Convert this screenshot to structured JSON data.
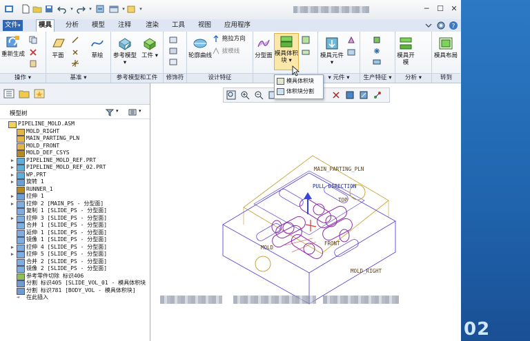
{
  "menu": {
    "file": "文件",
    "file_arrow": "▾"
  },
  "tabs": [
    "模具",
    "分析",
    "模型",
    "注释",
    "渲染",
    "工具",
    "视图",
    "应用程序"
  ],
  "ribbon": {
    "operations": {
      "regen": "重新生成",
      "label": "操作"
    },
    "datum": {
      "plane": "平面",
      "sketch": "草绘",
      "label": "基准"
    },
    "ref": {
      "ref_model": "参考模型",
      "workpiece": "工件",
      "label": "参考模型和工件"
    },
    "decor": {
      "label": "修饰符"
    },
    "design": {
      "contour": "轮廓曲线",
      "draft_dir": "拖拉方向",
      "draft_check": "拔模线",
      "label": "设计特征"
    },
    "parting": {
      "surface": "分型面",
      "volume": "模具体积块",
      "label": "分型面"
    },
    "component": {
      "mold_comp": "模具元件",
      "label": "元件"
    },
    "production": {
      "label": "生产特征"
    },
    "analysis": {
      "open": "模具开模",
      "label": "分析"
    },
    "layout": {
      "mold_layout": "模具布局",
      "label": "转到"
    }
  },
  "dropdown": {
    "item1": "模具体积块",
    "item2": "体积块分割"
  },
  "panel": {
    "title": "模型树"
  },
  "tree": [
    {
      "exp": "",
      "icon": "asm",
      "text": "PIPELINE_MOLD.ASM",
      "indent": 0
    },
    {
      "exp": "",
      "icon": "plane",
      "text": "MOLD_RIGHT",
      "indent": 1
    },
    {
      "exp": "",
      "icon": "plane",
      "text": "MAIN_PARTING_PLN",
      "indent": 1
    },
    {
      "exp": "",
      "icon": "plane",
      "text": "MOLD_FRONT",
      "indent": 1
    },
    {
      "exp": "",
      "icon": "csys",
      "text": "MOLD_DEF_CSYS",
      "indent": 1
    },
    {
      "exp": "▶",
      "icon": "part",
      "text": "PIPELINE_MOLD_REF.PRT",
      "indent": 1
    },
    {
      "exp": "▶",
      "icon": "part",
      "text": "PIPELINE_MOLD_REF_02.PRT",
      "indent": 1
    },
    {
      "exp": "▶",
      "icon": "part",
      "text": "WP.PRT",
      "indent": 1
    },
    {
      "exp": "▶",
      "icon": "feat",
      "text": "旋转 1",
      "indent": 1
    },
    {
      "exp": "",
      "icon": "csys",
      "text": "RUNNER_1",
      "indent": 1
    },
    {
      "exp": "▶",
      "icon": "feat",
      "text": "拉伸 1",
      "indent": 1
    },
    {
      "exp": "▶",
      "icon": "surf",
      "text": "拉伸 2 [MAIN_PS - 分型面]",
      "indent": 1
    },
    {
      "exp": "",
      "icon": "surf",
      "text": "复制 1 [SLIDE_PS - 分型面]",
      "indent": 1
    },
    {
      "exp": "▶",
      "icon": "surf",
      "text": "拉伸 3 [SLIDE_PS - 分型面]",
      "indent": 1
    },
    {
      "exp": "",
      "icon": "surf",
      "text": "合并 1 [SLIDE_PS - 分型面]",
      "indent": 1
    },
    {
      "exp": "",
      "icon": "surf",
      "text": "延伸 1 [SLIDE_PS - 分型面]",
      "indent": 1
    },
    {
      "exp": "",
      "icon": "surf",
      "text": "镜像 1 [SLIDE_PS - 分型面]",
      "indent": 1
    },
    {
      "exp": "▶",
      "icon": "surf",
      "text": "拉伸 4 [SLIDE_PS - 分型面]",
      "indent": 1
    },
    {
      "exp": "▶",
      "icon": "surf",
      "text": "拉伸 5 [SLIDE_PS - 分型面]",
      "indent": 1
    },
    {
      "exp": "",
      "icon": "surf",
      "text": "合并 2 [SLIDE_PS - 分型面]",
      "indent": 1
    },
    {
      "exp": "",
      "icon": "surf",
      "text": "镜像 2 [SLIDE_PS - 分型面]",
      "indent": 1
    },
    {
      "exp": "",
      "icon": "cut",
      "text": "参考零件切除 标识406",
      "indent": 1
    },
    {
      "exp": "",
      "icon": "split",
      "text": "分割 标识405 [SLIDE_VOL_01 - 模具体积块",
      "indent": 1
    },
    {
      "exp": "",
      "icon": "split",
      "text": "分割 标识781 [BODY_VOL - 模具体积块]",
      "indent": 1
    },
    {
      "exp": "",
      "icon": "insert",
      "text": "在此插入",
      "indent": 1
    }
  ],
  "model": {
    "main_parting": "MAIN_PARTING_PLN",
    "pull_direction": "PULL DIRECTION",
    "top": "TOP",
    "mold_right": "MOLD_RIGHT",
    "front": "FRONT",
    "mold": "MOLD"
  },
  "desktop": {
    "number": "02"
  },
  "colors": {
    "accent": "#1b5fa8",
    "geometry": "#5a46d6",
    "datum": "#c9a53a",
    "part": "#8d2aa8"
  }
}
